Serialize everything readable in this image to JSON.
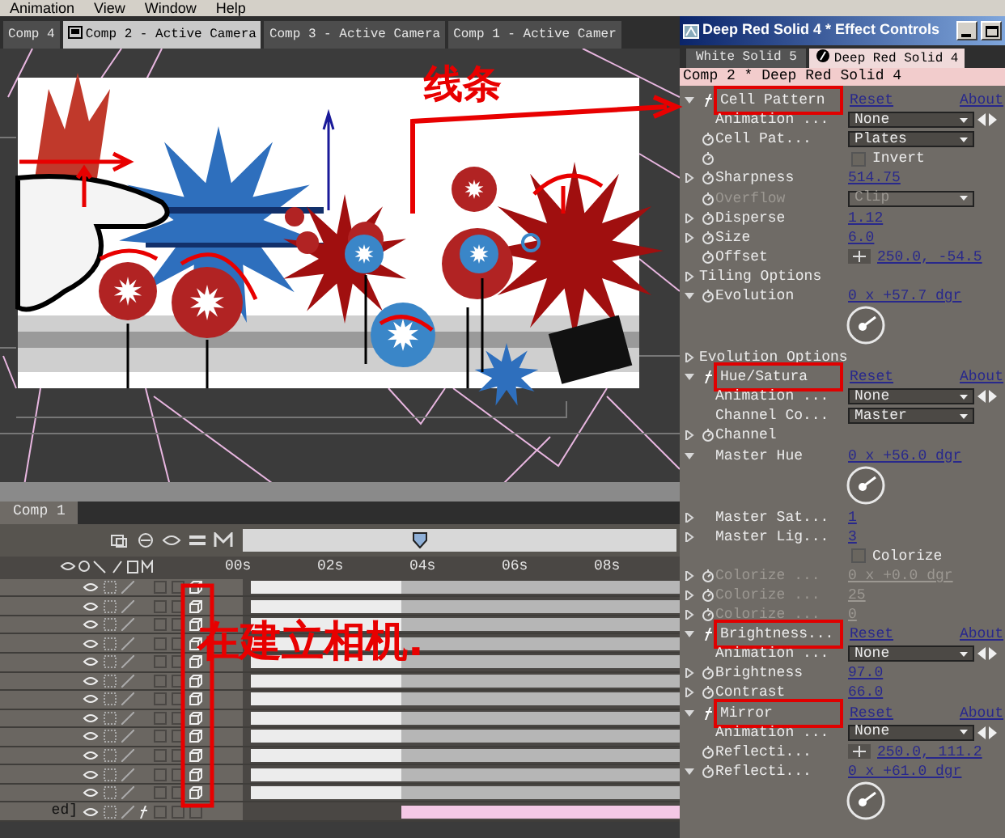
{
  "menu_bar": [
    "Animation",
    "View",
    "Window",
    "Help"
  ],
  "viewer": {
    "tabs": [
      {
        "label": "Comp 4",
        "selected": false
      },
      {
        "label": "Comp 2 - Active Camera",
        "selected": true
      },
      {
        "label": "Comp 3 - Active Camera",
        "selected": false
      },
      {
        "label": "Comp 1 - Active Camer",
        "selected": false
      }
    ]
  },
  "effect_controls": {
    "title": "Deep Red Solid 4 * Effect Controls",
    "tabs": [
      {
        "label": "White Solid 5",
        "selected": false
      },
      {
        "label": "Deep Red Solid 4",
        "selected": true
      }
    ],
    "header": "Comp 2 * Deep Red Solid 4",
    "rows": [
      {
        "kind": "effect",
        "name": "Cell Pattern",
        "reset": "Reset",
        "about": "About",
        "expanded": true,
        "annotated": true
      },
      {
        "kind": "dropdown",
        "label": "Animation ...",
        "value": "None",
        "stopwatch": false,
        "keyframe_nav": true
      },
      {
        "kind": "dropdown",
        "label": "Cell Pat...",
        "value": "Plates",
        "stopwatch": true,
        "keyframe_nav": false
      },
      {
        "kind": "checkbox",
        "text": "Invert",
        "stopwatch": true,
        "checked": false
      },
      {
        "kind": "value",
        "label": "Sharpness",
        "value": "514.75",
        "stopwatch": true,
        "expanded": false,
        "disabled": false
      },
      {
        "kind": "dropdown",
        "label": "Overflow",
        "value": "Clip",
        "stopwatch": true,
        "keyframe_nav": false,
        "disabled": true
      },
      {
        "kind": "value",
        "label": "Disperse",
        "value": "1.12",
        "stopwatch": true,
        "expanded": false,
        "disabled": false
      },
      {
        "kind": "value",
        "label": "Size",
        "value": "6.0",
        "stopwatch": true,
        "expanded": false,
        "disabled": false
      },
      {
        "kind": "point",
        "label": "Offset",
        "value": "250.0, -54.5",
        "stopwatch": true
      },
      {
        "kind": "group",
        "label": "Tiling Options",
        "expanded": false
      },
      {
        "kind": "angle",
        "label": "Evolution",
        "value": "0 x +57.7 dgr",
        "stopwatch": true,
        "expanded": true
      },
      {
        "kind": "group",
        "label": "Evolution Options",
        "expanded": false
      },
      {
        "kind": "effect",
        "name": "Hue/Satura",
        "reset": "Reset",
        "about": "About",
        "expanded": true,
        "annotated": true
      },
      {
        "kind": "dropdown",
        "label": "Animation ...",
        "value": "None",
        "stopwatch": false,
        "keyframe_nav": true
      },
      {
        "kind": "dropdown",
        "label": "Channel Co...",
        "value": "Master",
        "stopwatch": false,
        "keyframe_nav": false
      },
      {
        "kind": "value",
        "label": "Channel",
        "stopwatch": true,
        "expanded": false,
        "disabled": false
      },
      {
        "kind": "angle",
        "label": "Master Hue",
        "value": "0 x +56.0 dgr",
        "stopwatch": false,
        "expanded": true
      },
      {
        "kind": "value",
        "label": "Master Sat...",
        "value": "1",
        "stopwatch": false,
        "expanded": false,
        "disabled": false
      },
      {
        "kind": "value",
        "label": "Master Lig...",
        "value": "3",
        "stopwatch": false,
        "expanded": false,
        "disabled": false
      },
      {
        "kind": "checkbox",
        "text": "Colorize",
        "stopwatch": false,
        "checked": false
      },
      {
        "kind": "value",
        "label": "Colorize ...",
        "value": "0 x +0.0 dgr",
        "stopwatch": true,
        "expanded": false,
        "disabled": true
      },
      {
        "kind": "value",
        "label": "Colorize ...",
        "value": "25",
        "stopwatch": true,
        "expanded": false,
        "disabled": true
      },
      {
        "kind": "value",
        "label": "Colorize ...",
        "value": "0",
        "stopwatch": true,
        "expanded": false,
        "disabled": true
      },
      {
        "kind": "effect",
        "name": "Brightness...",
        "reset": "Reset",
        "about": "About",
        "expanded": true,
        "annotated": true
      },
      {
        "kind": "dropdown",
        "label": "Animation ...",
        "value": "None",
        "stopwatch": false,
        "keyframe_nav": true
      },
      {
        "kind": "value",
        "label": "Brightness",
        "value": "97.0",
        "stopwatch": true,
        "expanded": false,
        "disabled": false
      },
      {
        "kind": "value",
        "label": "Contrast",
        "value": "66.0",
        "stopwatch": true,
        "expanded": false,
        "disabled": false
      },
      {
        "kind": "effect",
        "name": "Mirror",
        "reset": "Reset",
        "about": "About",
        "expanded": true,
        "annotated": true
      },
      {
        "kind": "dropdown",
        "label": "Animation ...",
        "value": "None",
        "stopwatch": false,
        "keyframe_nav": true
      },
      {
        "kind": "point",
        "label": "Reflecti...",
        "value": "250.0, 111.2",
        "stopwatch": true
      },
      {
        "kind": "angle",
        "label": "Reflecti...",
        "value": "0 x +61.0 dgr",
        "stopwatch": true,
        "expanded": true
      }
    ]
  },
  "timeline": {
    "tab": "Comp 1",
    "time_navigator": {
      "level": 0.41
    },
    "ruler": [
      "00s",
      "02s",
      "04s",
      "06s",
      "08s"
    ],
    "layers": [
      {
        "kind": "layer",
        "three_d": true,
        "effects": false,
        "color": "#ececec"
      },
      {
        "kind": "layer",
        "three_d": true,
        "effects": false,
        "color": "#ececec"
      },
      {
        "kind": "layer",
        "three_d": true,
        "effects": false,
        "color": "#ececec"
      },
      {
        "kind": "layer",
        "three_d": true,
        "effects": false,
        "color": "#ececec"
      },
      {
        "kind": "layer",
        "three_d": true,
        "effects": false,
        "color": "#ececec"
      },
      {
        "kind": "layer",
        "three_d": true,
        "effects": false,
        "color": "#ececec"
      },
      {
        "kind": "layer",
        "three_d": true,
        "effects": false,
        "color": "#ececec"
      },
      {
        "kind": "layer",
        "three_d": true,
        "effects": false,
        "color": "#ececec"
      },
      {
        "kind": "layer",
        "three_d": true,
        "effects": false,
        "color": "#ececec"
      },
      {
        "kind": "layer",
        "three_d": true,
        "effects": false,
        "color": "#ececec"
      },
      {
        "kind": "layer",
        "three_d": true,
        "effects": false,
        "color": "#ececec"
      },
      {
        "kind": "layer",
        "three_d": true,
        "effects": false,
        "color": "#ececec"
      },
      {
        "kind": "adjustment",
        "name": "ed]",
        "three_d": false,
        "effects": true,
        "color": "#f4c8e6"
      }
    ]
  },
  "annotations": [
    {
      "kind": "viewer_note",
      "text": "线条"
    },
    {
      "kind": "timeline_note",
      "text": "在建立相机."
    }
  ]
}
